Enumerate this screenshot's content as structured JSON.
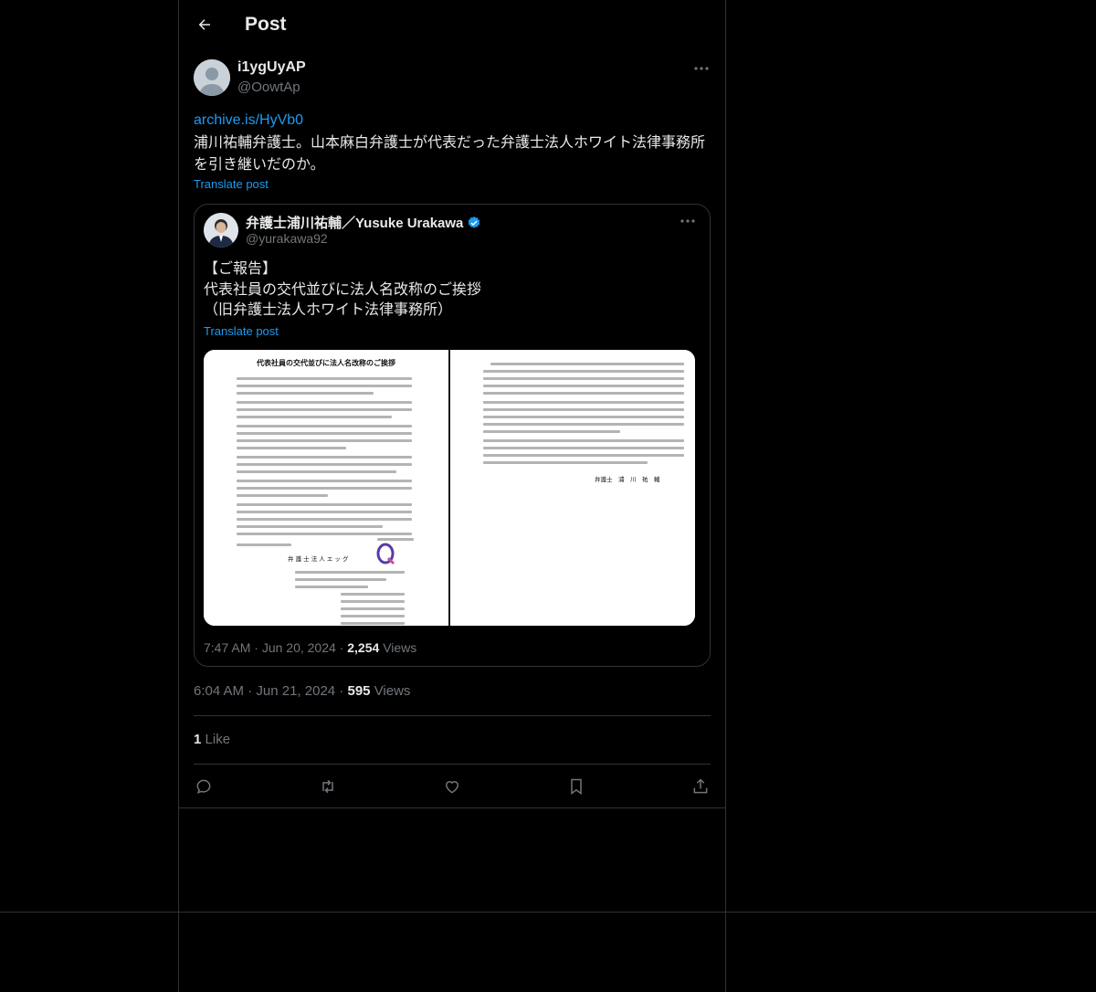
{
  "header": {
    "title": "Post"
  },
  "post": {
    "author_name": "i1ygUyAP",
    "handle": "@OowtAp",
    "link": "archive.is/HyVb0",
    "text": "浦川祐輔弁護士。山本麻白弁護士が代表だった弁護士法人ホワイト法律事務所を引き継いだのか。",
    "translate_label": "Translate post",
    "time": "6:04 AM",
    "date": "Jun 21, 2024",
    "views_count": "595",
    "views_label": "Views",
    "likes_count": "1",
    "likes_label": "Like"
  },
  "quote": {
    "author_name": "弁護士浦川祐輔／Yusuke Urakawa",
    "handle": "@yurakawa92",
    "text": "【ご報告】\n代表社員の交代並びに法人名改称のご挨拶\n（旧弁護士法人ホワイト法律事務所）",
    "translate_label": "Translate post",
    "time": "7:47 AM",
    "date": "Jun 20, 2024",
    "views_count": "2,254",
    "views_label": "Views",
    "image": {
      "left_title": "代表社員の交代並びに法人名改称のご挨拶",
      "firm_name": "弁 護 士 法 人 エ ッ グ",
      "signature": "弁護士　浦　川　祐　輔"
    }
  },
  "icons": {
    "back": "arrow-left-icon",
    "more": "more-horizontal-icon",
    "verified": "verified-badge-icon",
    "reply": "reply-icon",
    "repost": "repost-icon",
    "like": "heart-icon",
    "bookmark": "bookmark-icon",
    "share": "share-icon"
  },
  "colors": {
    "accent": "#1d9bf0",
    "muted": "#71767b",
    "background": "#000000",
    "border": "#2f3336"
  }
}
